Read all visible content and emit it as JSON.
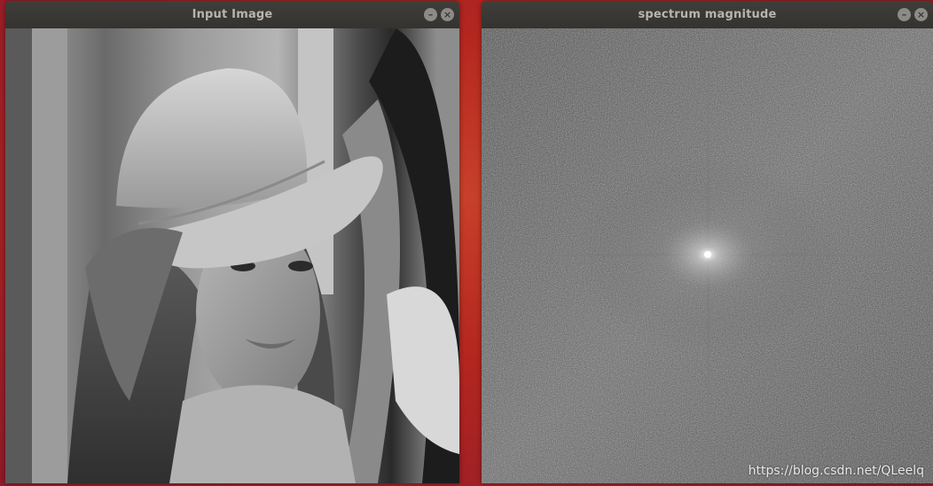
{
  "windows": {
    "input": {
      "title": "Input Image",
      "minimize_icon": "minimize-icon",
      "close_icon": "close-icon"
    },
    "spectrum": {
      "title": "spectrum magnitude",
      "minimize_icon": "minimize-icon",
      "close_icon": "close-icon"
    }
  },
  "watermark": "https://blog.csdn.net/QLeelq",
  "colors": {
    "desktop": "#b3261f",
    "titlebar": "#3a3935",
    "title_text": "#b9b5ad",
    "button": "#8d8b86"
  }
}
